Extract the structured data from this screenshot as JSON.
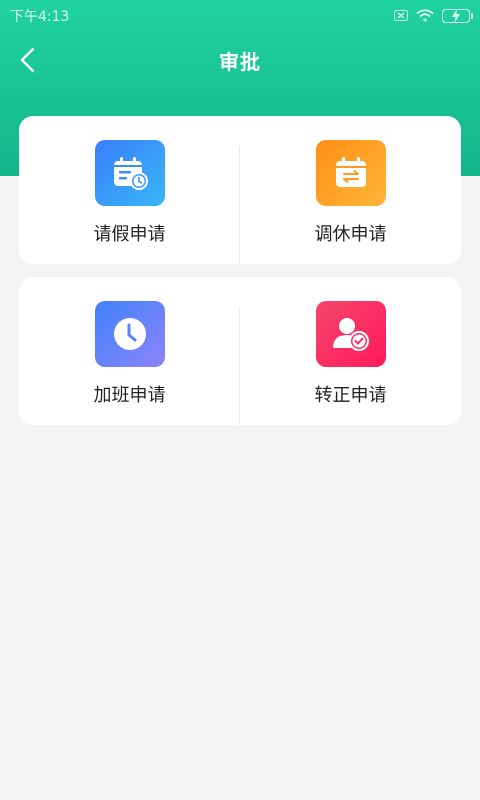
{
  "status_bar": {
    "time": "下午4:13"
  },
  "nav": {
    "title": "审批"
  },
  "menu": [
    {
      "label": "请假申请",
      "icon": "calendar-clock-icon",
      "color": "#3a7dfb"
    },
    {
      "label": "调休申请",
      "icon": "calendar-swap-icon",
      "color": "#ff9a1f"
    },
    {
      "label": "加班申请",
      "icon": "clock-icon",
      "color": "#6f84fb"
    },
    {
      "label": "转正申请",
      "icon": "user-check-icon",
      "color": "#f5325f"
    }
  ],
  "colors": {
    "header": "#1ac596",
    "background": "#f4f4f4"
  }
}
